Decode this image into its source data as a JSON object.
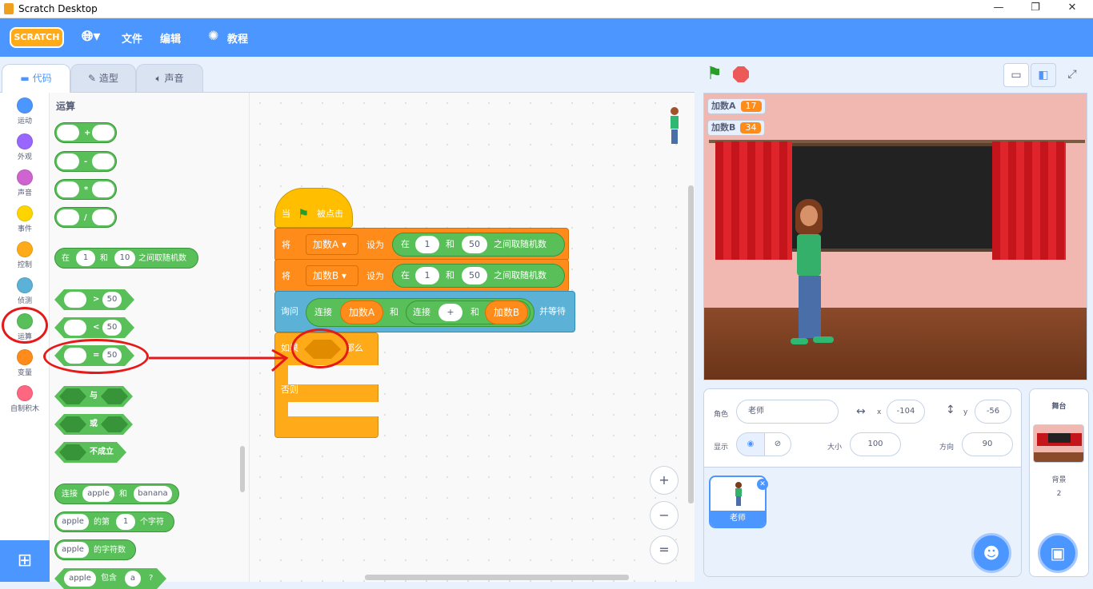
{
  "window": {
    "title": "Scratch Desktop",
    "controls": [
      "—",
      "❐",
      "✕"
    ]
  },
  "menubar": {
    "logo": "SCRATCH",
    "file": "文件",
    "edit": "编辑",
    "tutorials": "教程"
  },
  "tabs": {
    "code": "代码",
    "costumes": "造型",
    "sounds": "声音"
  },
  "categories": [
    {
      "label": "运动",
      "color": "#4c97ff"
    },
    {
      "label": "外观",
      "color": "#9966ff"
    },
    {
      "label": "声音",
      "color": "#cf63cf"
    },
    {
      "label": "事件",
      "color": "#ffd500"
    },
    {
      "label": "控制",
      "color": "#ffab19"
    },
    {
      "label": "侦测",
      "color": "#5cb1d6"
    },
    {
      "label": "运算",
      "color": "#59c059"
    },
    {
      "label": "变量",
      "color": "#ff8c1a"
    },
    {
      "label": "自制积木",
      "color": "#ff6680"
    }
  ],
  "palette": {
    "heading": "运算",
    "add": "+",
    "sub": "-",
    "mul": "*",
    "div": "/",
    "random": {
      "a": "在",
      "from": "1",
      "and": "和",
      "to": "10",
      "b": "之间取随机数"
    },
    "gt": {
      "op": ">",
      "val": "50"
    },
    "lt": {
      "op": "<",
      "val": "50"
    },
    "eq": {
      "op": "=",
      "val": "50"
    },
    "and": "与",
    "or": "或",
    "not": "不成立",
    "join": {
      "a": "连接",
      "s1": "apple",
      "and": "和",
      "s2": "banana"
    },
    "letter": {
      "s": "apple",
      "a": "的第",
      "n": "1",
      "b": "个字符"
    },
    "length": {
      "s": "apple",
      "a": "的字符数"
    },
    "contains": {
      "s": "apple",
      "a": "包含",
      "b": "a",
      "q": "?"
    }
  },
  "script": {
    "hat": {
      "when": "当",
      "clicked": "被点击"
    },
    "set": "将",
    "to": "设为",
    "varA": "加数A",
    "varB": "加数B",
    "rand": {
      "a": "在",
      "from": "1",
      "and": "和",
      "to": "50",
      "b": "之间取随机数"
    },
    "ask": {
      "label": "询问",
      "join": "连接",
      "and": "和",
      "plus": "+",
      "wait": "并等待"
    },
    "ifelse": {
      "if": "如果",
      "then": "那么",
      "else": "否则"
    }
  },
  "zoom": {
    "in": "+",
    "out": "−",
    "reset": "="
  },
  "monitors": [
    {
      "name": "加数A",
      "value": "17"
    },
    {
      "name": "加数B",
      "value": "34"
    }
  ],
  "sprite_info": {
    "sprite_label": "角色",
    "sprite_name": "老师",
    "x_label": "x",
    "x": "-104",
    "y_label": "y",
    "y": "-56",
    "show_label": "显示",
    "size_label": "大小",
    "size": "100",
    "direction_label": "方向",
    "direction": "90"
  },
  "sprites": [
    {
      "name": "老师"
    }
  ],
  "stage_pane": {
    "title": "舞台",
    "backdrops_label": "背景",
    "backdrops_count": "2"
  }
}
